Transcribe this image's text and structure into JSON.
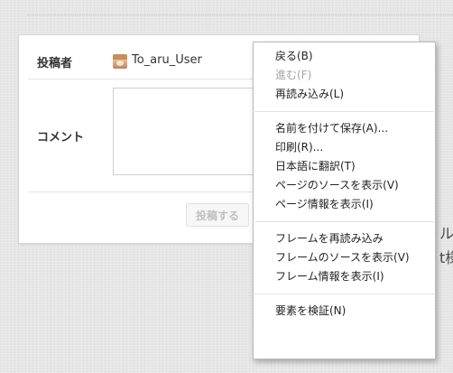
{
  "form": {
    "close_icon": "×",
    "author_label": "投稿者",
    "author_name": "To_aru_User",
    "comment_label": "コメント",
    "comment_value": "",
    "submit_label": "投稿する"
  },
  "background_text": {
    "fragment_1": "ル",
    "fragment_2": "t様"
  },
  "context_menu": {
    "groups": [
      [
        {
          "label": "戻る(B)",
          "enabled": true
        },
        {
          "label": "進む(F)",
          "enabled": false
        },
        {
          "label": "再読み込み(L)",
          "enabled": true
        }
      ],
      [
        {
          "label": "名前を付けて保存(A)...",
          "enabled": true
        },
        {
          "label": "印刷(R)...",
          "enabled": true
        },
        {
          "label": "日本語に翻訳(T)",
          "enabled": true
        },
        {
          "label": "ページのソースを表示(V)",
          "enabled": true
        },
        {
          "label": "ページ情報を表示(I)",
          "enabled": true
        }
      ],
      [
        {
          "label": "フレームを再読み込み",
          "enabled": true
        },
        {
          "label": "フレームのソースを表示(V)",
          "enabled": true
        },
        {
          "label": "フレーム情報を表示(I)",
          "enabled": true
        }
      ],
      [
        {
          "label": "要素を検証(N)",
          "enabled": true
        }
      ]
    ]
  }
}
